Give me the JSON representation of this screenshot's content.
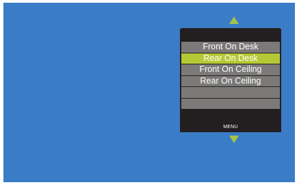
{
  "colors": {
    "screen_background": "#3a7cc6",
    "menu_background": "#231f20",
    "item_background": "#7b7a79",
    "selected_item_background": "#b5c936",
    "arrow": "#a6c34a",
    "text": "#ffffff"
  },
  "menu": {
    "items": [
      {
        "label": "Front On Desk",
        "selected": false
      },
      {
        "label": "Rear On Desk",
        "selected": true
      },
      {
        "label": "Front On Ceiling",
        "selected": false
      },
      {
        "label": "Rear On Ceiling",
        "selected": false
      },
      {
        "label": "",
        "selected": false
      },
      {
        "label": "",
        "selected": false
      }
    ],
    "footer_label": "MENU",
    "up_icon": "triangle-up-icon",
    "down_icon": "triangle-down-icon"
  }
}
